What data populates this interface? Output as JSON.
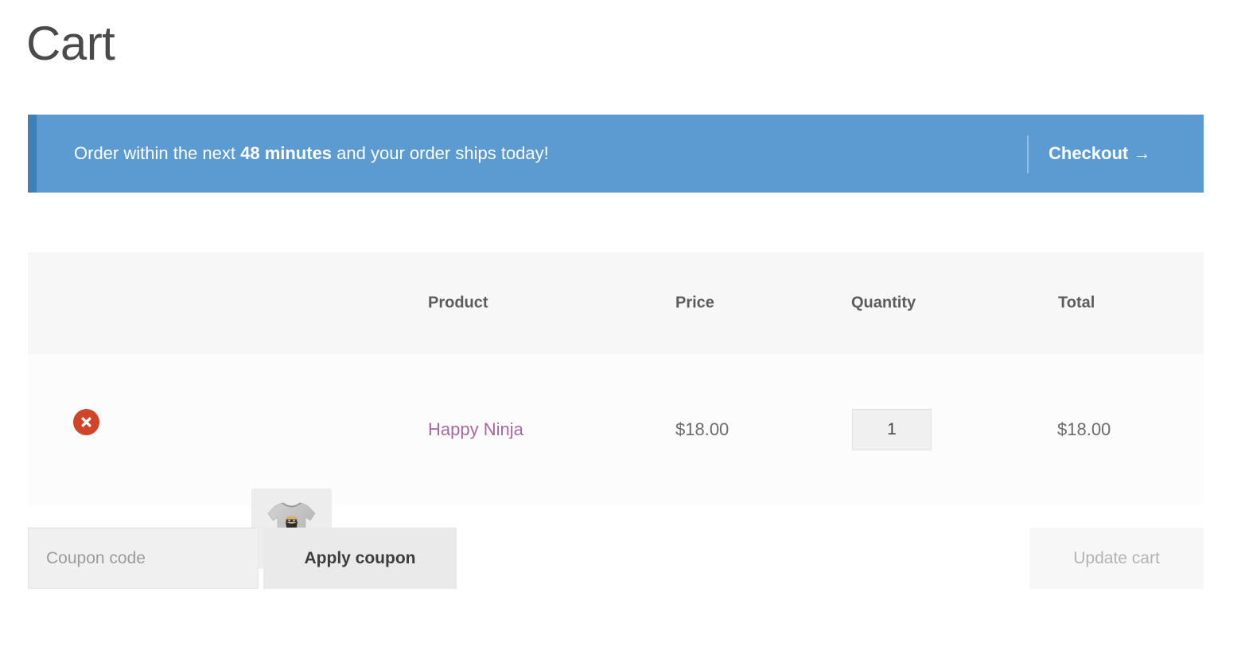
{
  "page": {
    "title": "Cart"
  },
  "promo": {
    "message_prefix": "Order within the next ",
    "message_highlight": "48 minutes",
    "message_suffix": " and your order ships today!",
    "checkout_label": "Checkout →",
    "background_color": "#5b9bd1",
    "accent_color": "#3d80b5"
  },
  "cart": {
    "columns": [
      "",
      "",
      "Product",
      "Price",
      "Quantity",
      "Total"
    ],
    "headers": {
      "product": "Product",
      "price": "Price",
      "quantity": "Quantity",
      "total": "Total"
    },
    "rows": [
      {
        "remove_label": "×",
        "thumbnail_alt": "Happy Ninja t-shirt",
        "product_name": "Happy Ninja",
        "price": "$18.00",
        "quantity": "1",
        "total": "$18.00",
        "product_link_color": "#a6689e"
      }
    ]
  },
  "actions": {
    "coupon_placeholder": "Coupon code",
    "coupon_value": "",
    "apply_coupon_label": "Apply coupon",
    "update_cart_label": "Update cart"
  },
  "icons": {
    "remove": "close-circle-icon",
    "checkout_arrow": "arrow-right-icon"
  }
}
